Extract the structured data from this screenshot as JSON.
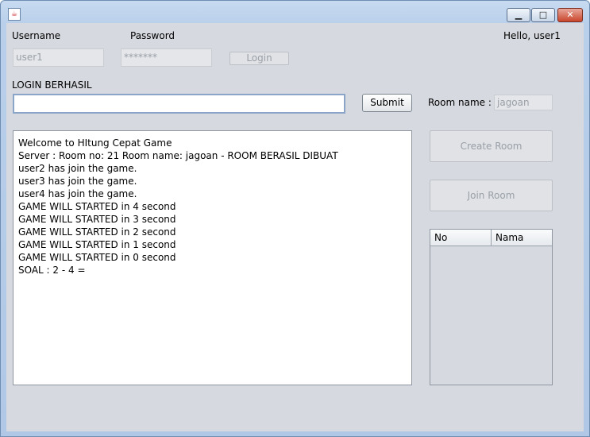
{
  "window": {
    "app_icon": "java-icon",
    "controls": {
      "minimize": "▁",
      "maximize": "□",
      "close": "✕"
    }
  },
  "login": {
    "username_label": "Username",
    "password_label": "Password",
    "username_value": "user1",
    "password_value": "*******",
    "login_button": "Login",
    "greeting": "Hello, user1",
    "status": "LOGIN BERHASIL"
  },
  "chat": {
    "input_value": "",
    "submit_button": "Submit",
    "messages": [
      "Welcome to HItung Cepat Game",
      "Server : Room no: 21 Room name: jagoan - ROOM BERASIL DIBUAT",
      "user2 has join the game.",
      "user3 has join the game.",
      "user4 has join the game.",
      "GAME WILL STARTED in 4 second",
      "GAME WILL STARTED in 3 second",
      "GAME WILL STARTED in 2 second",
      "GAME WILL STARTED in 1 second",
      "GAME WILL STARTED in 0 second",
      "SOAL : 2 - 4 ="
    ]
  },
  "room": {
    "name_label": "Room name :",
    "name_value": "jagoan",
    "create_button": "Create Room",
    "join_button": "Join Room",
    "table": {
      "columns": [
        "No",
        "Nama"
      ],
      "rows": []
    }
  }
}
